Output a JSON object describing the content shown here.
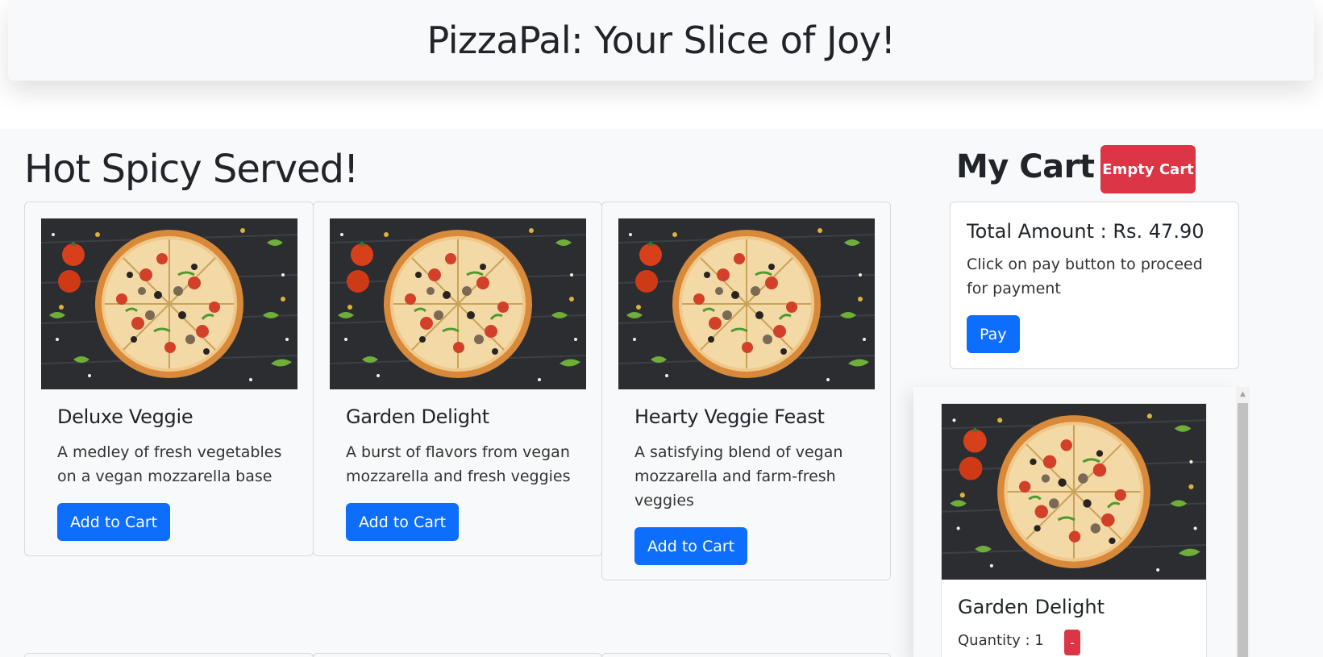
{
  "header": {
    "title": "PizzaPal: Your Slice of Joy!"
  },
  "menu": {
    "section_title": "Hot Spicy Served!",
    "items": [
      {
        "name": "Deluxe Veggie",
        "description": "A medley of fresh vegetables on a vegan mozzarella base",
        "button_label": "Add to Cart"
      },
      {
        "name": "Garden Delight",
        "description": "A burst of flavors from vegan mozzarella and fresh veggies",
        "button_label": "Add to Cart"
      },
      {
        "name": "Hearty Veggie Feast",
        "description": "A satisfying blend of vegan mozzarella and farm-fresh veggies",
        "button_label": "Add to Cart"
      }
    ]
  },
  "cart": {
    "title": "My Cart",
    "empty_label": "Empty Cart",
    "total_text": "Total Amount : Rs. 47.90",
    "note": "Click on pay button to proceed for payment",
    "pay_label": "Pay",
    "items": [
      {
        "name": "Garden Delight",
        "quantity_text": "Quantity : 1",
        "remove_label": "-"
      }
    ]
  },
  "colors": {
    "primary": "#0d6efd",
    "danger": "#dc3545",
    "background": "#f8f9fa"
  }
}
